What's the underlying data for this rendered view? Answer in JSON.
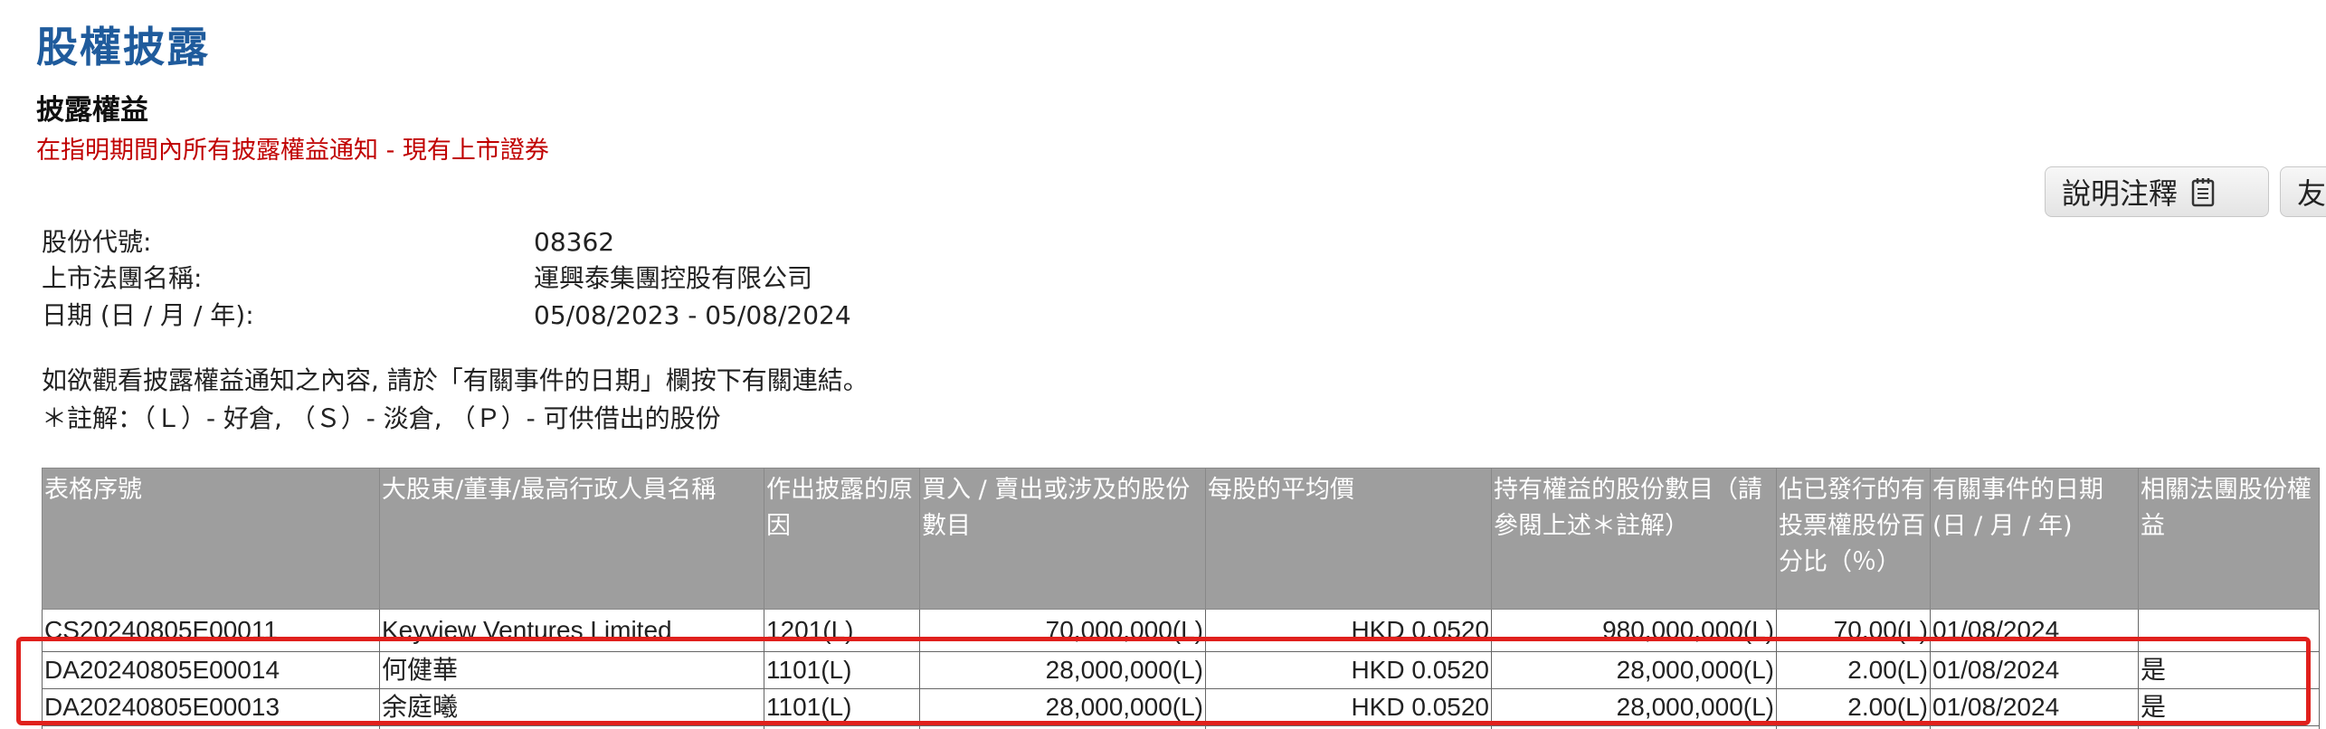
{
  "page": {
    "title": "股權披露",
    "section_title": "披露權益",
    "section_subtitle": "在指明期間內所有披露權益通知 - 現有上市證券"
  },
  "buttons": {
    "notes_label": "說明注釋",
    "print_label": "友"
  },
  "info": {
    "stock_code_label": "股份代號:",
    "stock_code_value": "08362",
    "company_label": "上市法團名稱:",
    "company_value": "運興泰集團控股有限公司",
    "date_label": "日期 (日 / 月 / 年):",
    "date_value": "05/08/2023 - 05/08/2024"
  },
  "notes": {
    "line1": "如欲觀看披露權益通知之內容, 請於「有關事件的日期」欄按下有關連結。",
    "line2": "＊註解：（Ｌ）- 好倉, （Ｓ）- 淡倉, （Ｐ）- 可供借出的股份"
  },
  "table": {
    "headers": [
      "表格序號",
      "大股東/董事/最高行政人員名稱",
      "作出披露的原因",
      "買入 / 賣出或涉及的股份數目",
      "每股的平均價",
      "持有權益的股份數目（請參閱上述＊註解）",
      "佔已發行的有投票權股份百分比（％）",
      "有關事件的日期 (日 / 月 / 年)",
      "相關法團股份權益"
    ],
    "rows": [
      {
        "form_no": "CS20240805E00011",
        "name": "Keyview Ventures Limited",
        "reason": "1201(L)",
        "shares_involved": "70,000,000(L)",
        "avg_price": "HKD 0.0520",
        "shares_held": "980,000,000(L)",
        "percent": "70.00(L)",
        "date": "01/08/2024",
        "corp_interest": ""
      },
      {
        "form_no": "DA20240805E00014",
        "name": "何健華",
        "reason": "1101(L)",
        "shares_involved": "28,000,000(L)",
        "avg_price": "HKD 0.0520",
        "shares_held": "28,000,000(L)",
        "percent": "2.00(L)",
        "date": "01/08/2024",
        "corp_interest": "是"
      },
      {
        "form_no": "DA20240805E00013",
        "name": "余庭曦",
        "reason": "1101(L)",
        "shares_involved": "28,000,000(L)",
        "avg_price": "HKD 0.0520",
        "shares_held": "28,000,000(L)",
        "percent": "2.00(L)",
        "date": "01/08/2024",
        "corp_interest": "是"
      }
    ]
  },
  "colors": {
    "title_blue": "#1f5b9c",
    "subtitle_red": "#c00000",
    "header_gray": "#9e9e9e",
    "highlight_red": "#e0201c"
  },
  "icons": {
    "notes_button_icon": "notepad-icon"
  }
}
